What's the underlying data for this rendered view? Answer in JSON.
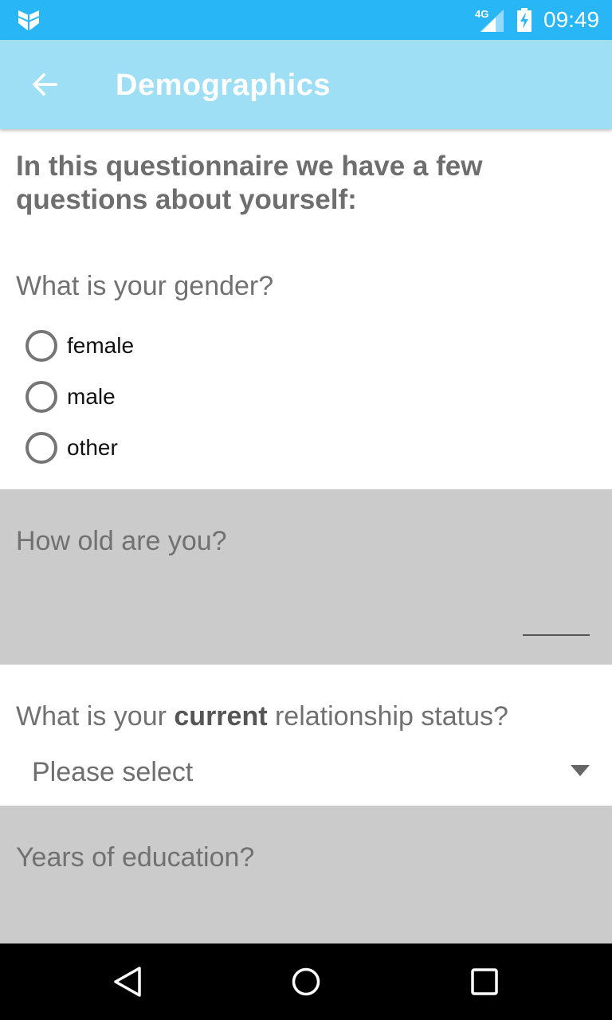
{
  "status_bar": {
    "network": "4G",
    "time": "09:49",
    "icons": [
      "app-logo-icon",
      "signal-icon",
      "battery-charging-icon"
    ]
  },
  "app_bar": {
    "title": "Demographics",
    "back_icon": "arrow-back-icon"
  },
  "intro": "In this questionnaire we have a few questions about yourself:",
  "gender": {
    "label": "What is your gender?",
    "options": [
      "female",
      "male",
      "other"
    ]
  },
  "age": {
    "label": "How old are you?",
    "value": ""
  },
  "relationship": {
    "label_before": "What is your ",
    "label_bold": "current",
    "label_after": " relationship status?",
    "selected": "Please select",
    "arrow_icon": "dropdown-arrow-icon"
  },
  "education": {
    "label": "Years of education?"
  },
  "nav_bar": {
    "icons": [
      "back-triangle-icon",
      "home-circle-icon",
      "recents-square-icon"
    ]
  },
  "colors": {
    "status_bar": "#29b6f6",
    "app_bar": "#9fdff6",
    "grey_section": "#cbcbcb"
  }
}
